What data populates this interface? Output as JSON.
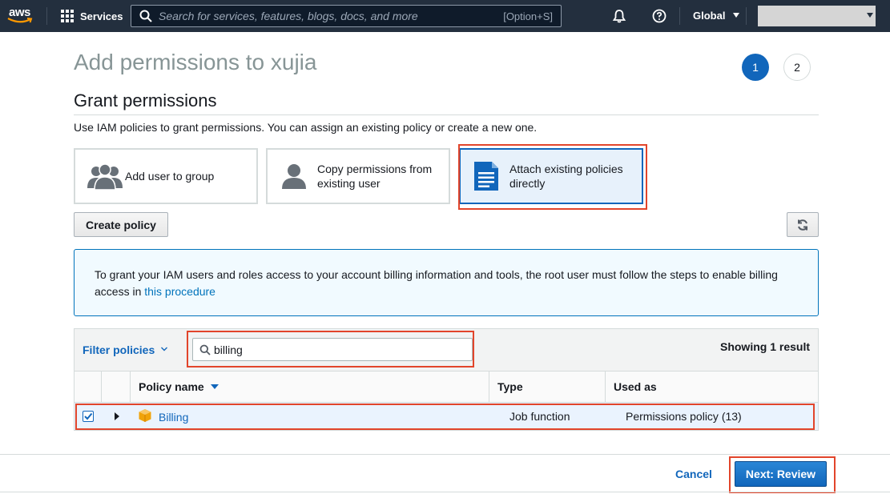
{
  "nav": {
    "logo_text": "aws",
    "services_label": "Services",
    "search_placeholder": "Search for services, features, blogs, docs, and more",
    "search_shortcut": "[Option+S]",
    "region_label": "Global"
  },
  "page": {
    "title": "Add permissions to xujia",
    "steps": [
      "1",
      "2"
    ],
    "section_title": "Grant permissions",
    "section_description": "Use IAM policies to grant permissions. You can assign an existing policy or create a new one."
  },
  "options": [
    {
      "label": "Add user to group",
      "icon": "users-group-icon"
    },
    {
      "label": "Copy permissions from existing user",
      "icon": "user-icon"
    },
    {
      "label": "Attach existing policies directly",
      "icon": "document-icon",
      "selected": true
    }
  ],
  "actions": {
    "create_policy_label": "Create policy",
    "refresh_icon": "refresh-icon"
  },
  "info": {
    "text": "To grant your IAM users and roles access to your account billing information and tools, the root user must follow the steps to enable billing access in ",
    "link_text": "this procedure"
  },
  "table": {
    "filter_label": "Filter policies",
    "filter_value": "billing",
    "showing_text": "Showing 1 result",
    "columns": [
      "Policy name",
      "Type",
      "Used as"
    ],
    "rows": [
      {
        "checked": true,
        "name": "Billing",
        "type": "Job function",
        "used_as": "Permissions policy (13)"
      }
    ]
  },
  "footer": {
    "cancel_label": "Cancel",
    "next_label": "Next: Review"
  },
  "colors": {
    "nav_bg": "#232f3e",
    "primary": "#1166bb",
    "highlight": "#e2452b",
    "selected_bg": "#e7f1fb"
  }
}
